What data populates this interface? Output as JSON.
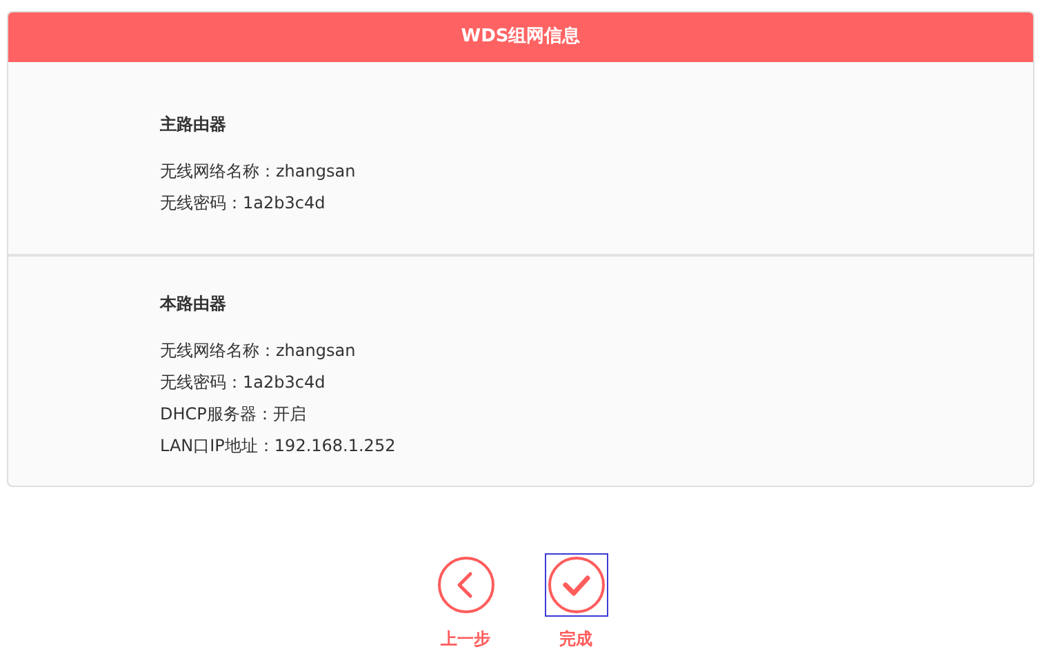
{
  "panel": {
    "title": "WDS组网信息",
    "sections": [
      {
        "heading": "主路由器",
        "lines": [
          "无线网络名称：zhangsan",
          "无线密码：1a2b3c4d"
        ]
      },
      {
        "heading": "本路由器",
        "lines": [
          "无线网络名称：zhangsan",
          "无线密码：1a2b3c4d",
          "DHCP服务器：开启",
          "LAN口IP地址：192.168.1.252"
        ]
      }
    ]
  },
  "buttons": [
    {
      "kind": "back",
      "label": "上一步",
      "focused": false
    },
    {
      "kind": "done",
      "label": "完成",
      "focused": true
    }
  ]
}
